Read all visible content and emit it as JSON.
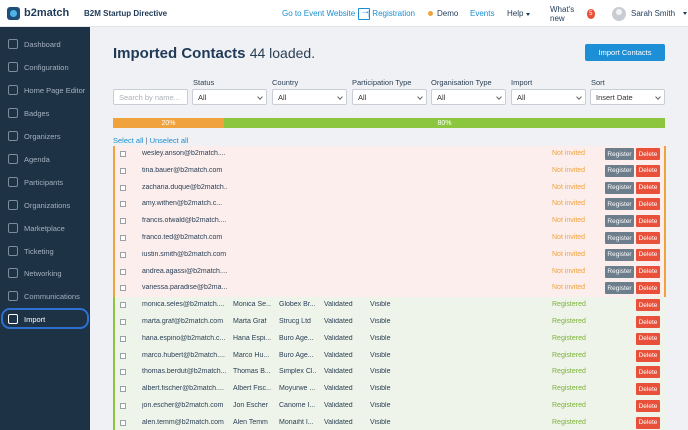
{
  "header": {
    "logo_text": "b2match",
    "event_title": "B2M Startup Directive",
    "goto_event": "Go to Event Website",
    "registration": "| Registration",
    "demo": "Demo",
    "events": "Events",
    "help": "Help",
    "whats_new": "What's new",
    "whats_new_count": "5",
    "user_name": "Sarah Smith"
  },
  "sidebar": {
    "items": [
      {
        "label": "Dashboard",
        "icon": "dashboard-icon"
      },
      {
        "label": "Configuration",
        "icon": "wrench-icon"
      },
      {
        "label": "Home Page Editor",
        "icon": "home-icon"
      },
      {
        "label": "Badges",
        "icon": "badge-icon"
      },
      {
        "label": "Organizers",
        "icon": "users-icon"
      },
      {
        "label": "Agenda",
        "icon": "calendar-icon"
      },
      {
        "label": "Participants",
        "icon": "participants-icon"
      },
      {
        "label": "Organizations",
        "icon": "building-icon"
      },
      {
        "label": "Marketplace",
        "icon": "store-icon"
      },
      {
        "label": "Ticketing",
        "icon": "ticket-icon"
      },
      {
        "label": "Networking",
        "icon": "network-icon"
      },
      {
        "label": "Communications",
        "icon": "chat-icon"
      },
      {
        "label": "Import",
        "icon": "import-icon"
      }
    ],
    "active": "Import"
  },
  "main": {
    "title": "Imported Contacts",
    "count_text": "44 loaded.",
    "import_button": "Import Contacts",
    "search_placeholder": "Search by name...",
    "filters": [
      {
        "label": "Status",
        "value": "All"
      },
      {
        "label": "Country",
        "value": "All"
      },
      {
        "label": "Participation Type",
        "value": "All"
      },
      {
        "label": "Organisation Type",
        "value": "All"
      },
      {
        "label": "Import",
        "value": "All"
      },
      {
        "label": "Sort",
        "value": "Insert Date"
      }
    ],
    "progress": {
      "not_invited_percent": 20,
      "registered_percent": 80,
      "not_invited_label": "20%",
      "registered_label": "80%"
    },
    "select_all": "Select all",
    "separator": "|",
    "unselect_all": "Unselect all",
    "register_label": "Register",
    "delete_label": "Delete",
    "colors": {
      "not_invited": "#f0a23c",
      "registered": "#8cc63e",
      "accent": "#1c8fd6",
      "delete": "#e8503a"
    },
    "rows": [
      {
        "email": "wesley.anson@b2match....",
        "name": "",
        "org": "",
        "validated": "",
        "visible": "",
        "status": "Not invited"
      },
      {
        "email": "tina.bauer@b2match.com",
        "name": "",
        "org": "",
        "validated": "",
        "visible": "",
        "status": "Not invited"
      },
      {
        "email": "zacharia.duque@b2match...",
        "name": "",
        "org": "",
        "validated": "",
        "visible": "",
        "status": "Not invited"
      },
      {
        "email": "amy.withen@b2match.c...",
        "name": "",
        "org": "",
        "validated": "",
        "visible": "",
        "status": "Not invited"
      },
      {
        "email": "francis.otwald@b2match....",
        "name": "",
        "org": "",
        "validated": "",
        "visible": "",
        "status": "Not invited"
      },
      {
        "email": "franco.ted@b2match.com",
        "name": "",
        "org": "",
        "validated": "",
        "visible": "",
        "status": "Not invited"
      },
      {
        "email": "iustin.smith@b2match.com",
        "name": "",
        "org": "",
        "validated": "",
        "visible": "",
        "status": "Not invited"
      },
      {
        "email": "andrea.agassi@b2match....",
        "name": "",
        "org": "",
        "validated": "",
        "visible": "",
        "status": "Not invited"
      },
      {
        "email": "vanessa.paradise@b2ma...",
        "name": "",
        "org": "",
        "validated": "",
        "visible": "",
        "status": "Not invited"
      },
      {
        "email": "monica.seles@b2match....",
        "name": "Monica Se...",
        "org": "Globex Br...",
        "validated": "Validated",
        "visible": "Visible",
        "status": "Registered"
      },
      {
        "email": "marta.graf@b2match.com",
        "name": "Marta Graf",
        "org": "Strucg Ltd",
        "validated": "Validated",
        "visible": "Visible",
        "status": "Registered"
      },
      {
        "email": "hana.espino@b2match.c...",
        "name": "Hana Espi...",
        "org": "Buro Age...",
        "validated": "Validated",
        "visible": "Visible",
        "status": "Registered"
      },
      {
        "email": "marco.hubert@b2match....",
        "name": "Marco Hu...",
        "org": "Buro Age...",
        "validated": "Validated",
        "visible": "Visible",
        "status": "Registered"
      },
      {
        "email": "thomas.berdut@b2match....",
        "name": "Thomas B...",
        "org": "Simplex Cl...",
        "validated": "Validated",
        "visible": "Visible",
        "status": "Registered"
      },
      {
        "email": "albert.fischer@b2match....",
        "name": "Albert Fisc...",
        "org": "Moyurwe ...",
        "validated": "Validated",
        "visible": "Visible",
        "status": "Registered"
      },
      {
        "email": "jon.escher@b2match.com",
        "name": "Jon Escher",
        "org": "Canome I...",
        "validated": "Validated",
        "visible": "Visible",
        "status": "Registered"
      },
      {
        "email": "alen.temm@b2match.com",
        "name": "Alen Temm",
        "org": "Monaiht I...",
        "validated": "Validated",
        "visible": "Visible",
        "status": "Registered"
      }
    ]
  }
}
